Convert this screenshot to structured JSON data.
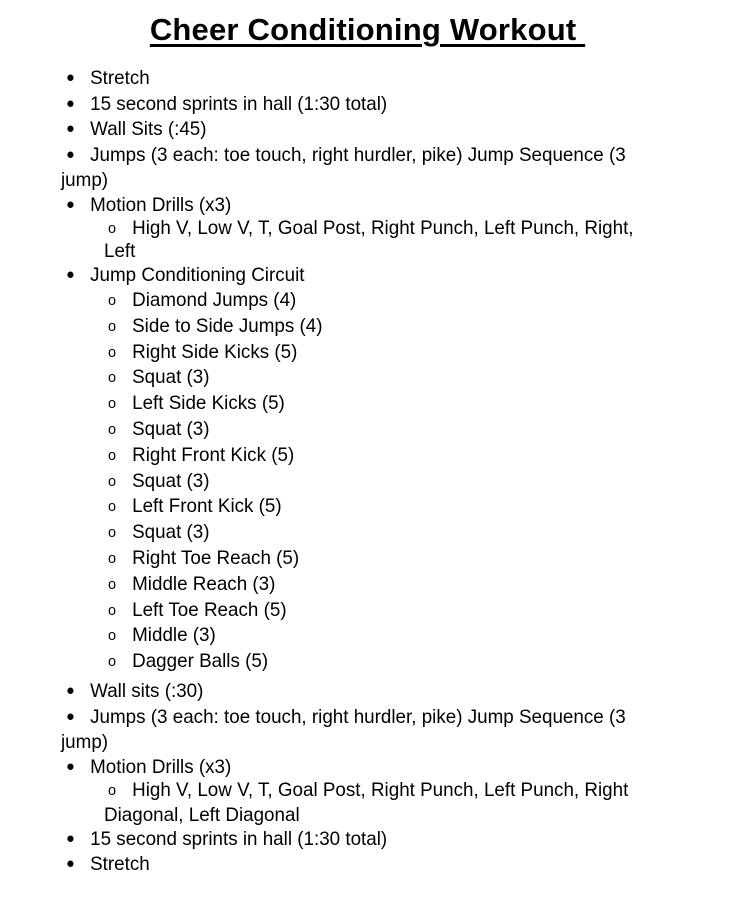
{
  "document": {
    "title": "Cheer Conditioning Workout ",
    "bullet_icons": {
      "level1": "●",
      "level2": "o"
    },
    "items": [
      {
        "text": "Stretch"
      },
      {
        "text": "15 second sprints in hall (1:30 total)"
      },
      {
        "text": "Wall Sits (:45)"
      },
      {
        "text": "Jumps (3 each: toe touch, right hurdler, pike) Jump Sequence (3",
        "continuation": "jump)"
      },
      {
        "text": "Motion Drills (x3)",
        "sub": [
          {
            "text": "High V, Low V, T, Goal Post, Right Punch, Left Punch, Right,",
            "continuation": "Left"
          }
        ]
      },
      {
        "text": "Jump Conditioning Circuit",
        "sub": [
          {
            "text": "Diamond Jumps (4)"
          },
          {
            "text": "Side to Side Jumps (4)"
          },
          {
            "text": "Right Side Kicks (5)"
          },
          {
            "text": "Squat (3)"
          },
          {
            "text": "Left Side Kicks (5)"
          },
          {
            "text": "Squat (3)"
          },
          {
            "text": "Right Front Kick (5)"
          },
          {
            "text": "Squat (3)"
          },
          {
            "text": "Left Front Kick (5)"
          },
          {
            "text": "Squat (3)"
          },
          {
            "text": "Right Toe Reach (5)"
          },
          {
            "text": "Middle Reach (3)"
          },
          {
            "text": "Left Toe Reach (5)"
          },
          {
            "text": "Middle (3)"
          },
          {
            "text": "Dagger Balls (5)"
          }
        ]
      },
      {
        "text": "Wall sits (:30)"
      },
      {
        "text": "Jumps (3 each: toe touch, right hurdler, pike) Jump Sequence (3",
        "continuation": "jump)"
      },
      {
        "text": "Motion Drills (x3)",
        "sub": [
          {
            "text": "High V, Low V, T, Goal Post, Right Punch, Left Punch, Right",
            "continuation": "Diagonal, Left Diagonal"
          }
        ]
      },
      {
        "text": "15 second sprints in hall (1:30 total)"
      },
      {
        "text": "Stretch"
      }
    ]
  }
}
